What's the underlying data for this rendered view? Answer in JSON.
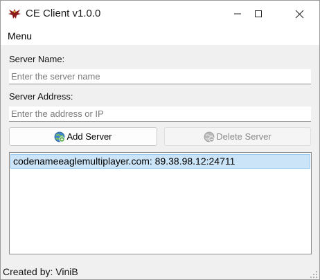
{
  "window": {
    "title": "CE Client v1.0.0"
  },
  "menubar": {
    "items": [
      {
        "label": "Menu"
      }
    ]
  },
  "form": {
    "server_name_label": "Server Name:",
    "server_name_value": "",
    "server_name_placeholder": "Enter the server name",
    "server_address_label": "Server Address:",
    "server_address_value": "",
    "server_address_placeholder": "Enter the address or IP"
  },
  "buttons": {
    "add_label": "Add Server",
    "add_icon": "globe-add-icon",
    "delete_label": "Delete Server",
    "delete_icon": "globe-delete-icon",
    "delete_enabled": false
  },
  "server_list": {
    "items": [
      {
        "text": "codenameeaglemultiplayer.com: 89.38.98.12:24711",
        "selected": true
      }
    ]
  },
  "status": {
    "text": "Created by: ViniB"
  },
  "colors": {
    "selection_bg": "#cce4f7",
    "selection_border": "#99c9ef",
    "window_bg": "#f0f0f0"
  }
}
